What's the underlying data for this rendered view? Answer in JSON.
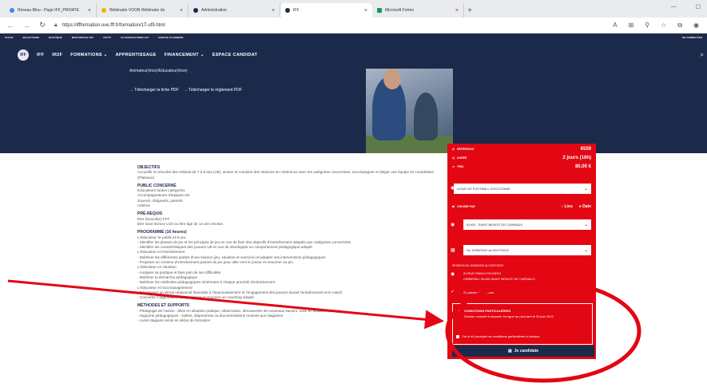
{
  "browser": {
    "tabs": [
      {
        "label": "Réseau Bleu - Page IFF_PRIVATE"
      },
      {
        "label": "Webinaire VOON Webinaire do"
      },
      {
        "label": "Administration"
      },
      {
        "label": "IFF"
      },
      {
        "label": "Microsoft Forms"
      }
    ],
    "url": "https://iffformation.ove.fff.fr/formation/1T-uf9.html"
  },
  "topstrip": {
    "items": [
      "FFF.FR",
      "BILLETTERIE",
      "BOUTIQUE",
      "MON ESPACE FFF",
      "FFFTV",
      "CLASSIFICATIONS LFF",
      "ESPACE CLUBBERS"
    ],
    "right": "SE CONNECTER"
  },
  "nav": {
    "logo": "IFF",
    "items": [
      "IFF",
      "IR2F",
      "FORMATIONS ⌄",
      "APPRENTISSAGE",
      "FINANCEMENT ⌄",
      "ESPACE CANDIDAT"
    ]
  },
  "hero": {
    "audience": "Animateur(trice)/Educateur(trice)",
    "link_pdf": "→ Télécharger la fiche PDF",
    "link_rules": "→ Télécharger le règlement PDF"
  },
  "panel": {
    "ref_label": "RÉFÉRENCE",
    "ref_value": "6559",
    "duration_label": "DURÉE",
    "duration_value": "2 jours (16h)",
    "price_label": "PRIX",
    "price_value": "80,00 €",
    "league_select": "LIGUE DE FOOTBALL D'OCCITANIE",
    "choose_label": "CHOISIR PAR",
    "opt_place": "○ Lieu",
    "opt_date": "● Date",
    "place_select": "81400 - SAINT BENOIT DE CARMAUX",
    "date_select": "Du 10/06/2022 au 02/07/2022",
    "session_label": "SESSION DU 30/06/2022 AU 02/07/2022",
    "addr1": "29 RUE PABLO PICASSO",
    "addr2": "CIRBESIN / 81400 SAINT BENOIT DE CARMAUX",
    "places": "21 places disponibles",
    "cond_title": "CONDITIONS PARTICULIÈRES",
    "cond_text": "Dossier complet à déposer en ligne au plus tard le 30 juin 2022",
    "cond_checkbox": "J'ai lu et j'accepte les conditions particulières ci-dessus",
    "apply": "Je candidate"
  },
  "content": {
    "obj_title": "OBJECTIFS",
    "obj_text": "Accueillir en sécurité des enfants de 7 à 9 ans (U9), animer et conduire des séances en cohérence avec les catégories concernées, accompagner et diriger une équipe en compétition (Plateaux).",
    "public_title": "PUBLIC CONCERNÉ",
    "public_lines": [
      "Educateurs toutes catégories",
      "Accompagnateurs d'équipes U9",
      "Joueurs, dirigeants, parents",
      "Arbitres"
    ],
    "prereq_title": "PRÉ-REQUIS",
    "prereq_lines": [
      "Etre licencié(e) FFF",
      "Etre sous licence U15 ou être âgé de 14 ans révolus"
    ],
    "prog_title": "PROGRAMME (16 heures)",
    "prog_lines": [
      "L'éducateur, le public et le jeu",
      "- Identifier les phases de jeu et les principes de jeu en vue de fixer des objectifs d'entraînement adaptés aux catégories concernées",
      "- Identifier les caractéristiques des joueurs U9 en vue de développer un comportement pédagogique adapté",
      "L'éducateur et l'entraînement",
      "- Maîtriser les différentes parties d'une séance (jeu, situation et exercice) et adapter ses interventions pédagogiques",
      "- Proposer un contenu d'entraînement partant du jeu pour aller vers le joueur et retourner au jeu",
      "L'éducateur en situation",
      "- Analyser sa pratique et faire part de ses difficultés",
      "- Maîtriser la démarche pédagogique",
      "- Maîtriser les méthodes pédagogiques inhérentes à chaque procédé d'entraînement",
      "L'éducateur et l'accompagnement",
      "- Développer un climat relationnel favorable à l'épanouissement et l'engagement des joueurs durant l'entraînement et le match",
      "- Connaître l'organisation des pratiques et proposer un coaching adapté"
    ],
    "methods_title": "MÉTHODES ET SUPPORTS",
    "methods_lines": [
      "- Pédagogie de l'action : Mise en situation pratique, observation, découvertes de nouveaux savoirs, mise en situation pratique",
      "- Supports pédagogiques : vidéos, diaporamas ou documentations remises aux stagiaires",
      "- Livret stagiaire remis en début de formation"
    ]
  },
  "colors": {
    "navy": "#1b2a4a",
    "red": "#e30613",
    "annotation": "#e30613"
  }
}
